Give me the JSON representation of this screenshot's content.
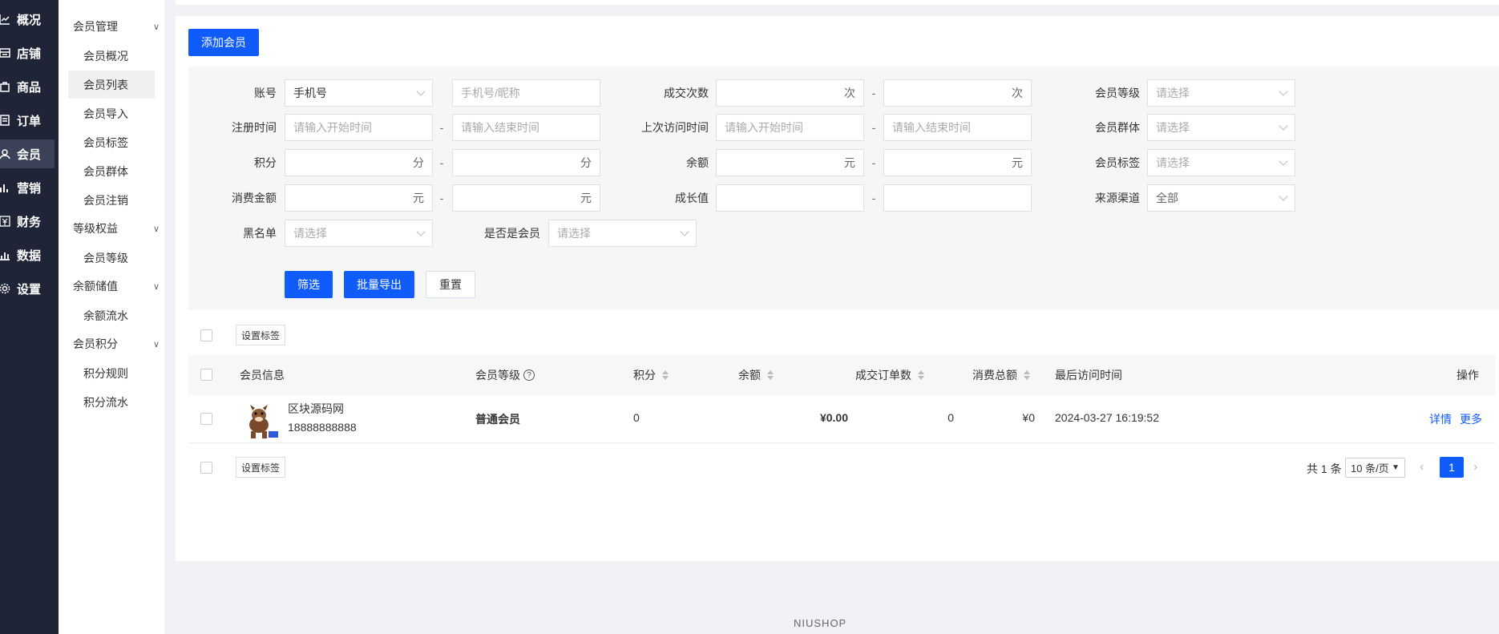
{
  "nav": {
    "items": [
      {
        "label": "概况",
        "icon": "chart-line-icon"
      },
      {
        "label": "店铺",
        "icon": "store-icon"
      },
      {
        "label": "商品",
        "icon": "goods-bag-icon"
      },
      {
        "label": "订单",
        "icon": "order-list-icon"
      },
      {
        "label": "会员",
        "icon": "user-icon"
      },
      {
        "label": "营销",
        "icon": "bar-chart-icon"
      },
      {
        "label": "财务",
        "icon": "yen-icon"
      },
      {
        "label": "数据",
        "icon": "data-stats-icon"
      },
      {
        "label": "设置",
        "icon": "gear-icon"
      }
    ],
    "active_index": 4
  },
  "sub_nav": {
    "groups": [
      {
        "label": "会员管理",
        "items": [
          "会员概况",
          "会员列表",
          "会员导入",
          "会员标签",
          "会员群体",
          "会员注销"
        ]
      },
      {
        "label": "等级权益",
        "items": [
          "会员等级"
        ]
      },
      {
        "label": "余额储值",
        "items": [
          "余额流水"
        ]
      },
      {
        "label": "会员积分",
        "items": [
          "积分规则",
          "积分流水"
        ]
      }
    ],
    "active_item": "会员列表"
  },
  "toolbar": {
    "add_member": "添加会员"
  },
  "filter": {
    "account_label": "账号",
    "account_type": "手机号",
    "account_placeholder": "手机号/昵称",
    "deal_count_label": "成交次数",
    "deal_unit": "次",
    "level_label": "会员等级",
    "select_placeholder": "请选择",
    "reg_time_label": "注册时间",
    "start_placeholder": "请输入开始时间",
    "end_placeholder": "请输入结束时间",
    "last_visit_label": "上次访问时间",
    "group_label": "会员群体",
    "points_label": "积分",
    "points_unit": "分",
    "balance_label": "余额",
    "yuan_unit": "元",
    "tag_label": "会员标签",
    "spend_label": "消费金额",
    "growth_label": "成长值",
    "source_label": "来源渠道",
    "source_value": "全部",
    "blacklist_label": "黑名单",
    "is_member_label": "是否是会员",
    "dash": "-",
    "btn_filter": "筛选",
    "btn_export": "批量导出",
    "btn_reset": "重置"
  },
  "table": {
    "set_tag": "设置标签",
    "columns": {
      "info": "会员信息",
      "level": "会员等级",
      "points": "积分",
      "balance": "余额",
      "orders": "成交订单数",
      "spend": "消费总额",
      "last_visit": "最后访问时间",
      "ops": "操作"
    },
    "help_mark": "?",
    "rows": [
      {
        "name": "区块源码网",
        "phone": "18888888888",
        "level": "普通会员",
        "points": "0",
        "balance": "¥0.00",
        "orders": "0",
        "spend": "¥0",
        "last_visit": "2024-03-27 16:19:52",
        "op_detail": "详情",
        "op_more": "更多"
      }
    ]
  },
  "pagination": {
    "total": "共 1 条",
    "page_size": "10 条/页",
    "current_page": "1"
  },
  "footer": {
    "brand": "NIUSHOP"
  },
  "colors": {
    "primary": "#105cfb",
    "nav_bg": "#1f2436"
  }
}
